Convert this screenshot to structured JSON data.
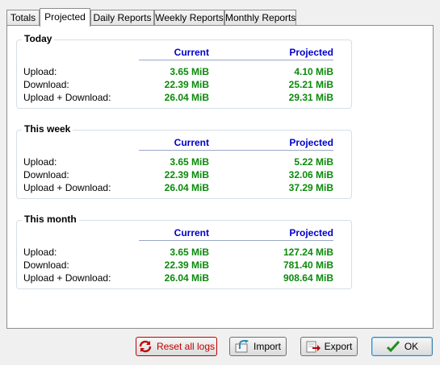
{
  "tabs": [
    {
      "label": "Totals"
    },
    {
      "label": "Projected",
      "active": true
    },
    {
      "label": "Daily Reports"
    },
    {
      "label": "Weekly Reports"
    },
    {
      "label": "Monthly Reports"
    }
  ],
  "columns": {
    "current": "Current",
    "projected": "Projected"
  },
  "row_labels": {
    "upload": "Upload:",
    "download": "Download:",
    "total": "Upload + Download:"
  },
  "groups": [
    {
      "title": "Today",
      "current": {
        "upload": "3.65 MiB",
        "download": "22.39 MiB",
        "total": "26.04 MiB"
      },
      "projected": {
        "upload": "4.10 MiB",
        "download": "25.21 MiB",
        "total": "29.31 MiB"
      }
    },
    {
      "title": "This week",
      "current": {
        "upload": "3.65 MiB",
        "download": "22.39 MiB",
        "total": "26.04 MiB"
      },
      "projected": {
        "upload": "5.22 MiB",
        "download": "32.06 MiB",
        "total": "37.29 MiB"
      }
    },
    {
      "title": "This month",
      "current": {
        "upload": "3.65 MiB",
        "download": "22.39 MiB",
        "total": "26.04 MiB"
      },
      "projected": {
        "upload": "127.24 MiB",
        "download": "781.40 MiB",
        "total": "908.64 MiB"
      }
    }
  ],
  "buttons": {
    "reset": "Reset all logs",
    "import": "Import",
    "export": "Export",
    "ok": "OK"
  },
  "colors": {
    "header": "#0000cc",
    "value": "#0a8a0a",
    "reset": "#c00000"
  }
}
